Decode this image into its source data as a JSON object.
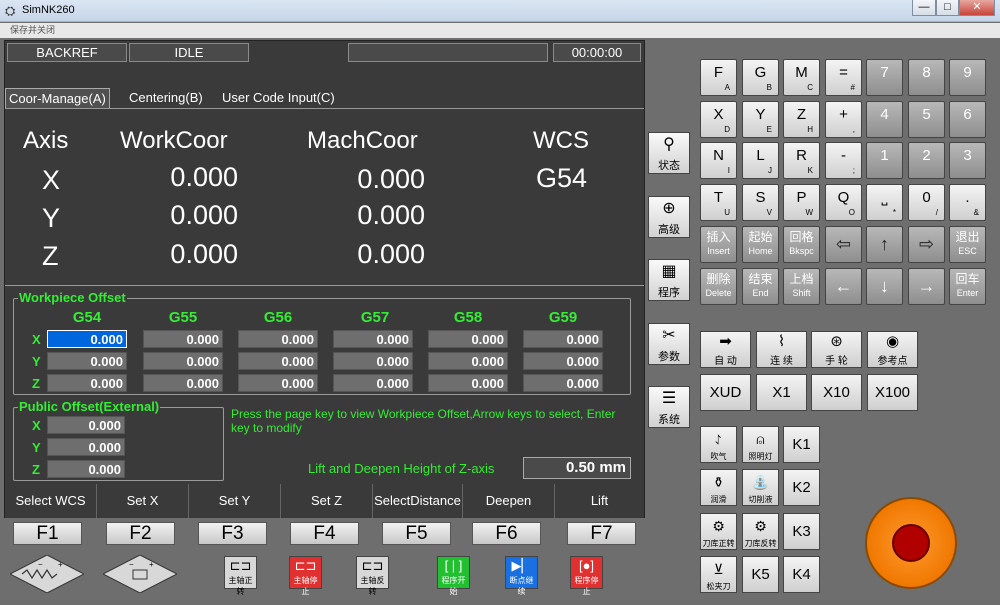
{
  "window": {
    "title": "SimNK260",
    "minimize": "—",
    "maximize": "□",
    "close": "✕"
  },
  "menu": {
    "label": "保存并关闭"
  },
  "status": {
    "mode": "BACKREF",
    "state": "IDLE",
    "message": "",
    "time": "00:00:00"
  },
  "tabs": [
    {
      "label": "Coor-Manage(A)"
    },
    {
      "label": "Centering(B)"
    },
    {
      "label": "User Code Input(C)"
    }
  ],
  "coords": {
    "header_axis": "Axis",
    "header_work": "WorkCoor",
    "header_mach": "MachCoor",
    "header_wcs": "WCS",
    "wcs": "G54",
    "rows": [
      {
        "axis": "X",
        "work": "0.000",
        "mach": "0.000"
      },
      {
        "axis": "Y",
        "work": "0.000",
        "mach": "0.000"
      },
      {
        "axis": "Z",
        "work": "0.000",
        "mach": "0.000"
      }
    ]
  },
  "workpiece": {
    "title": "Workpiece Offset",
    "cols": [
      "G54",
      "G55",
      "G56",
      "G57",
      "G58",
      "G59"
    ],
    "rows": [
      "X",
      "Y",
      "Z"
    ],
    "values": [
      [
        "0.000",
        "0.000",
        "0.000",
        "0.000",
        "0.000",
        "0.000"
      ],
      [
        "0.000",
        "0.000",
        "0.000",
        "0.000",
        "0.000",
        "0.000"
      ],
      [
        "0.000",
        "0.000",
        "0.000",
        "0.000",
        "0.000",
        "0.000"
      ]
    ]
  },
  "public": {
    "title": "Public Offset(External)",
    "rows": [
      {
        "axis": "X",
        "value": "0.000"
      },
      {
        "axis": "Y",
        "value": "0.000"
      },
      {
        "axis": "Z",
        "value": "0.000"
      }
    ]
  },
  "hint": "Press the page key to view Workpiece Offset,Arrow keys to select, Enter key to modify",
  "lift": {
    "label": "Lift and Deepen Height of Z-axis",
    "value": "0.50 mm"
  },
  "softkeys": [
    "Select WCS",
    "Set X",
    "Set Y",
    "Set Z",
    "SelectDistance",
    "Deepen",
    "Lift"
  ],
  "fkeys": [
    "F1",
    "F2",
    "F3",
    "F4",
    "F5",
    "F6",
    "F7"
  ],
  "spindle": [
    {
      "label": "主轴正转",
      "color": "#d8d8d8"
    },
    {
      "label": "主轴停止",
      "color": "#e03030"
    },
    {
      "label": "主轴反转",
      "color": "#d8d8d8"
    },
    {
      "label": "程序开始",
      "color": "#22c030"
    },
    {
      "label": "断点继续",
      "color": "#1a70e0"
    },
    {
      "label": "程序停止",
      "color": "#e03030"
    }
  ],
  "side": [
    {
      "label": "状态",
      "icon": "spindle-icon"
    },
    {
      "label": "高级",
      "icon": "crosshair-icon"
    },
    {
      "label": "程序",
      "icon": "program-icon"
    },
    {
      "label": "参数",
      "icon": "tools-icon"
    },
    {
      "label": "系统",
      "icon": "system-icon"
    }
  ],
  "keys": {
    "row1": [
      {
        "m": "F",
        "s": "A"
      },
      {
        "m": "G",
        "s": "B"
      },
      {
        "m": "M",
        "s": "C"
      },
      {
        "m": "=",
        "s": "#"
      },
      {
        "m": "7",
        "s": ""
      },
      {
        "m": "8",
        "s": ""
      },
      {
        "m": "9",
        "s": ""
      }
    ],
    "row2": [
      {
        "m": "X",
        "s": "D"
      },
      {
        "m": "Y",
        "s": "E"
      },
      {
        "m": "Z",
        "s": "H"
      },
      {
        "m": "+",
        "s": ","
      },
      {
        "m": "4",
        "s": ""
      },
      {
        "m": "5",
        "s": ""
      },
      {
        "m": "6",
        "s": ""
      }
    ],
    "row3": [
      {
        "m": "N",
        "s": "I"
      },
      {
        "m": "L",
        "s": "J"
      },
      {
        "m": "R",
        "s": "K"
      },
      {
        "m": "-",
        "s": ";"
      },
      {
        "m": "1",
        "s": ""
      },
      {
        "m": "2",
        "s": ""
      },
      {
        "m": "3",
        "s": ""
      }
    ],
    "row4": [
      {
        "m": "T",
        "s": "U"
      },
      {
        "m": "S",
        "s": "V"
      },
      {
        "m": "P",
        "s": "W"
      },
      {
        "m": "Q",
        "s": "O"
      },
      {
        "m": "⎵",
        "s": "*"
      },
      {
        "m": "0",
        "s": "/"
      },
      {
        "m": ".",
        "s": "&"
      }
    ],
    "row5": [
      {
        "cn": "插入",
        "en": "Insert"
      },
      {
        "cn": "起始",
        "en": "Home"
      },
      {
        "cn": "回格",
        "en": "Bkspc"
      },
      {
        "sym": "⇦"
      },
      {
        "sym": "↑"
      },
      {
        "sym": "⇨"
      },
      {
        "cn": "退出",
        "en": "ESC"
      }
    ],
    "row6": [
      {
        "cn": "删除",
        "en": "Delete"
      },
      {
        "cn": "结束",
        "en": "End"
      },
      {
        "cn": "上档",
        "en": "Shift"
      },
      {
        "sym": "←"
      },
      {
        "sym": "↓"
      },
      {
        "sym": "→"
      },
      {
        "cn": "回车",
        "en": "Enter"
      }
    ]
  },
  "modes": [
    {
      "label": "自 动",
      "icon": "➡"
    },
    {
      "label": "连 续",
      "icon": "⌇"
    },
    {
      "label": "手 轮",
      "icon": "⊛"
    },
    {
      "label": "参考点",
      "icon": "◉"
    }
  ],
  "multipliers": [
    "XUD",
    "X1",
    "X10",
    "X100"
  ],
  "aux": [
    {
      "label": "吹气"
    },
    {
      "label": "照明灯"
    },
    {
      "label": "润滑"
    },
    {
      "label": "切削液"
    },
    {
      "label": "刀库正转"
    },
    {
      "label": "刀库反转"
    },
    {
      "label": "松夹刀"
    }
  ],
  "kbuttons": [
    "K1",
    "K2",
    "K3",
    "K4",
    "K5"
  ]
}
